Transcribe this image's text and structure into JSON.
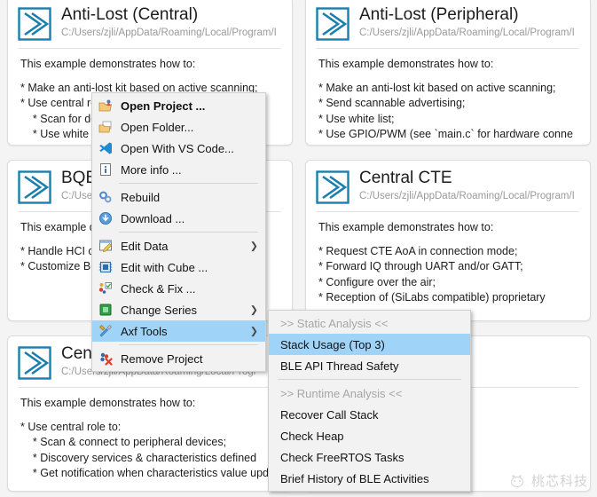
{
  "colors": {
    "accent": "#1b7fad",
    "selection": "#9fd3f7",
    "menu_bg": "#f2f2f2",
    "card_border": "#dcdcdc",
    "path_text": "#9a9a9a",
    "page_bg": "#f4f4f4"
  },
  "cards": [
    {
      "id": "anti-lost-central",
      "title": "Anti-Lost (Central)",
      "path": "C:/Users/zjli/AppData/Roaming/Local/Program/I",
      "icon": "double-chevron-icon",
      "intro": "This example demonstrates how to:",
      "bullets": [
        "* Make an anti-lost kit based on active scanning;",
        "* Use central role to:",
        "    * Scan for devices;",
        "    * Use white list;"
      ]
    },
    {
      "id": "anti-lost-peripheral",
      "title": "Anti-Lost (Peripheral)",
      "path": "C:/Users/zjli/AppData/Roaming/Local/Program/I",
      "icon": "double-chevron-icon",
      "intro": "This example demonstrates how to:",
      "bullets": [
        "* Make an anti-lost kit based on active scanning;",
        "* Send scannable advertising;",
        "* Use white list;",
        "* Use GPIO/PWM (see `main.c` for hardware conne"
      ]
    },
    {
      "id": "bqb",
      "title": "BQB",
      "path": "C:/Users",
      "path_tail": "m/I",
      "icon": "double-chevron-icon",
      "intro": "This example d",
      "bullets": [
        "* Handle HCI c",
        "* Customize BQ"
      ]
    },
    {
      "id": "central-cte",
      "title": "Central CTE",
      "path": "C:/Users/zjli/AppData/Roaming/Local/Program/I",
      "icon": "double-chevron-icon",
      "intro": "This example demonstrates how to:",
      "bullets": [
        "* Request CTE AoA in connection mode;",
        "* Forward IQ through UART and/or GATT;",
        "* Configure over the air;",
        "* Reception of (SiLabs compatible) proprietary"
      ]
    },
    {
      "id": "central",
      "title": "Centr",
      "path": "C:/Users/zjli/AppData/Roaming/Local/Progr",
      "icon": "double-chevron-icon",
      "intro": "This example demonstrates how to:",
      "bullets": [
        "* Use central role to:",
        "    * Scan & connect to peripheral devices;",
        "    * Discovery services & characteristics defined",
        "    * Get notification when characteristics value upd"
      ]
    },
    {
      "id": "bottom-right",
      "title": "",
      "path": "oaming/Local/Program/I",
      "icon": "double-chevron-icon",
      "intro": "",
      "bullets": []
    }
  ],
  "context_menu": {
    "items": [
      {
        "label": "Open Project ...",
        "icon": "open-project-icon",
        "bold": true,
        "sep_after": false,
        "submenu": false
      },
      {
        "label": "Open Folder...",
        "icon": "open-folder-icon",
        "bold": false,
        "sep_after": false,
        "submenu": false
      },
      {
        "label": "Open With VS Code...",
        "icon": "vs-code-icon",
        "bold": false,
        "sep_after": false,
        "submenu": false
      },
      {
        "label": "More info ...",
        "icon": "info-icon",
        "bold": false,
        "sep_after": true,
        "submenu": false
      },
      {
        "label": "Rebuild",
        "icon": "rebuild-gears-icon",
        "bold": false,
        "sep_after": false,
        "submenu": false
      },
      {
        "label": "Download ...",
        "icon": "download-icon",
        "bold": false,
        "sep_after": true,
        "submenu": false
      },
      {
        "label": "Edit Data",
        "icon": "edit-data-icon",
        "bold": false,
        "sep_after": false,
        "submenu": true
      },
      {
        "label": "Edit with Cube ...",
        "icon": "cube-chip-icon",
        "bold": false,
        "sep_after": false,
        "submenu": false
      },
      {
        "label": "Check & Fix ...",
        "icon": "check-fix-icon",
        "bold": false,
        "sep_after": false,
        "submenu": false
      },
      {
        "label": "Change Series",
        "icon": "chip-icon",
        "bold": false,
        "sep_after": false,
        "submenu": true
      },
      {
        "label": "Axf Tools",
        "icon": "tools-icon",
        "bold": false,
        "sep_after": true,
        "submenu": true,
        "selected": true
      },
      {
        "label": "Remove Project",
        "icon": "remove-project-icon",
        "bold": false,
        "sep_after": false,
        "submenu": false
      }
    ]
  },
  "submenu": {
    "items": [
      {
        "label": ">> Static Analysis <<",
        "header": true,
        "selected": false,
        "sep_after": false
      },
      {
        "label": "Stack Usage (Top 3)",
        "header": false,
        "selected": true,
        "sep_after": false
      },
      {
        "label": "BLE API Thread Safety",
        "header": false,
        "selected": false,
        "sep_after": true
      },
      {
        "label": ">> Runtime Analysis <<",
        "header": true,
        "selected": false,
        "sep_after": false
      },
      {
        "label": "Recover Call Stack",
        "header": false,
        "selected": false,
        "sep_after": false
      },
      {
        "label": "Check Heap",
        "header": false,
        "selected": false,
        "sep_after": false
      },
      {
        "label": "Check FreeRTOS Tasks",
        "header": false,
        "selected": false,
        "sep_after": false
      },
      {
        "label": "Brief History of BLE Activities",
        "header": false,
        "selected": false,
        "sep_after": false
      }
    ]
  },
  "watermark": {
    "text": "桃芯科技",
    "icon": "peach-logo-icon"
  }
}
